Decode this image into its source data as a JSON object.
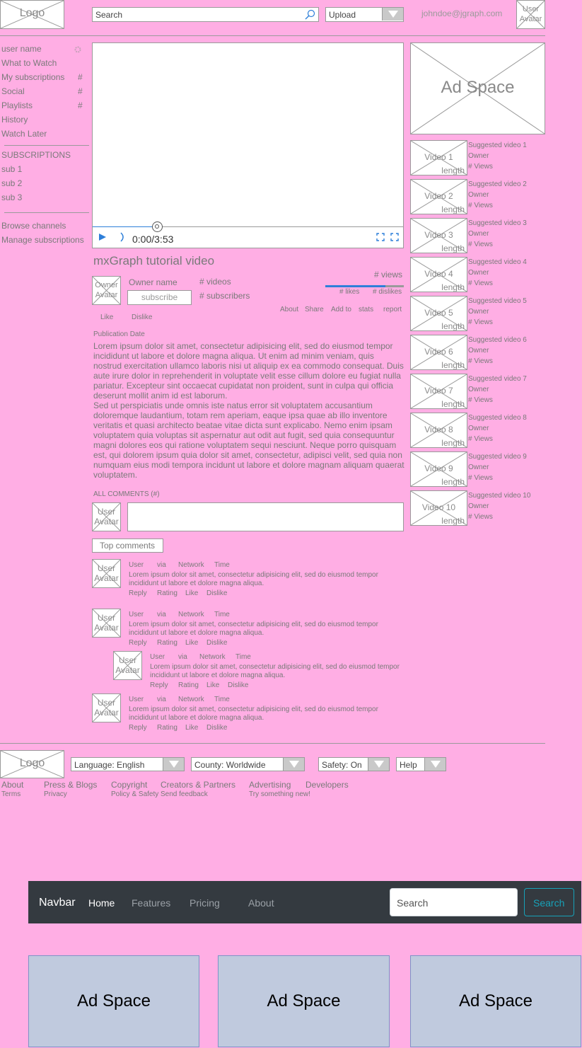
{
  "header": {
    "logo": "Logo",
    "search_placeholder": "Search",
    "upload": "Upload",
    "email": "johndoe@jgraph.com",
    "user_avatar": "User\nAvatar"
  },
  "sidebar": {
    "user_name": "user name",
    "items": [
      {
        "label": "What to Watch",
        "badge": ""
      },
      {
        "label": "My subscriptions",
        "badge": "#"
      },
      {
        "label": "Social",
        "badge": "#"
      },
      {
        "label": "Playlists",
        "badge": "#"
      },
      {
        "label": "History",
        "badge": ""
      },
      {
        "label": "Watch Later",
        "badge": ""
      }
    ],
    "subscriptions_heading": "SUBSCRIPTIONS",
    "subscriptions": [
      "sub 1",
      "sub 2",
      "sub 3"
    ],
    "browse_channels": "Browse channels",
    "manage_subscriptions": "Manage subscriptions"
  },
  "player": {
    "time": "0:00/3:53",
    "progress": 0.21
  },
  "video": {
    "title": "mxGraph tutorial video",
    "owner_avatar": "Owner\nAvatar",
    "owner_name": "Owner name",
    "subscribe": "subscribe",
    "videos": "# videos",
    "subscribers": "# subscribers",
    "views": "# views",
    "likes": "# likes",
    "dislikes": "# dislikes",
    "like_ratio": 0.77,
    "like": "Like",
    "dislike": "Dislike",
    "tabs": [
      "About",
      "Share",
      "Add to",
      "stats",
      "report"
    ],
    "publication_date": "Publication Date",
    "description": "Lorem ipsum dolor sit amet, consectetur adipisicing elit, sed do eiusmod tempor incididunt ut labore et dolore magna aliqua. Ut enim ad minim veniam, quis nostrud exercitation ullamco laboris nisi ut aliquip ex ea commodo consequat. Duis aute irure dolor in reprehenderit in voluptate velit esse cillum dolore eu fugiat nulla pariatur. Excepteur sint occaecat cupidatat non proident, sunt in culpa qui officia deserunt mollit anim id est laborum.\nSed ut perspiciatis unde omnis iste natus error sit voluptatem accusantium doloremque laudantium, totam rem aperiam, eaque ipsa quae ab illo inventore veritatis et quasi architecto beatae vitae dicta sunt explicabo. Nemo enim ipsam voluptatem quia voluptas sit aspernatur aut odit aut fugit, sed quia consequuntur magni dolores eos qui ratione voluptatem sequi nesciunt. Neque porro quisquam est, qui dolorem ipsum quia dolor sit amet, consectetur, adipisci velit, sed quia non numquam eius modi tempora incidunt ut labore et dolore magnam aliquam quaerat voluptatem."
  },
  "comments": {
    "heading": "ALL COMMENTS (#)",
    "user_avatar": "User\nAvatar",
    "top_comments": "Top comments",
    "meta": [
      "User",
      "via",
      "Network",
      "Time"
    ],
    "text": "Lorem ipsum dolor sit amet, consectetur adipisicing elit, sed do eiusmod tempor incididunt ut labore et dolore magna aliqua.",
    "actions": [
      "Reply",
      "Rating",
      "Like",
      "Dislike"
    ],
    "count": 4
  },
  "ad_right": "Ad Space",
  "suggested": [
    {
      "thumb": "Video 1",
      "title": "Suggested video 1"
    },
    {
      "thumb": "Video 2",
      "title": "Suggested video 2"
    },
    {
      "thumb": "Video 3",
      "title": "Suggested video 3"
    },
    {
      "thumb": "Video 4",
      "title": "Suggested video 4"
    },
    {
      "thumb": "Video 5",
      "title": "Suggested video 5"
    },
    {
      "thumb": "Video 6",
      "title": "Suggested video 6"
    },
    {
      "thumb": "Video 7",
      "title": "Suggested video 7"
    },
    {
      "thumb": "Video 8",
      "title": "Suggested video 8"
    },
    {
      "thumb": "Video 9",
      "title": "Suggested video 9"
    },
    {
      "thumb": "Video 10",
      "title": "Suggested video 10"
    }
  ],
  "suggested_common": {
    "length": "length",
    "owner": "Owner",
    "views": "# Views"
  },
  "footer": {
    "logo": "Logo",
    "language": "Language: English",
    "country": "County: Worldwide",
    "safety": "Safety: On",
    "help": "Help",
    "links": [
      "About",
      "Press & Blogs",
      "Copyright",
      "Creators & Partners",
      "Advertising",
      "Developers"
    ],
    "sublinks": [
      "Terms",
      "Privacy",
      "Policy & Safety",
      "Send feedback",
      "Try something new!"
    ]
  },
  "navbar": {
    "brand": "Navbar",
    "items": [
      "Home",
      "Features",
      "Pricing",
      "About"
    ],
    "search_placeholder": "Search",
    "search_button": "Search"
  },
  "ads": [
    "Ad Space",
    "Ad Space",
    "Ad Space"
  ],
  "colors": {
    "background": "#FFAEE4",
    "navbar": "#343a40",
    "ad_fill": "#c0cade",
    "accent": "#2e7fd9"
  }
}
